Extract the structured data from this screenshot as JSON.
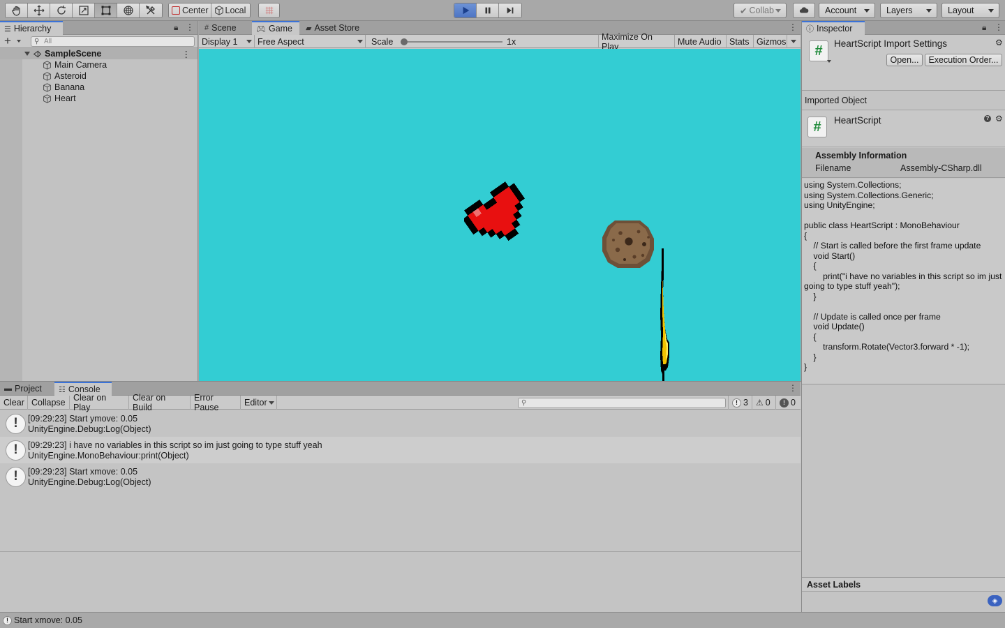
{
  "toolbar": {
    "pivot_label": "Center",
    "space_label": "Local",
    "collab_label": "Collab",
    "account_label": "Account",
    "layers_label": "Layers",
    "layout_label": "Layout"
  },
  "hierarchy": {
    "tab_label": "Hierarchy",
    "search_placeholder": "All",
    "scene_name": "SampleScene",
    "objects": [
      "Main Camera",
      "Asteroid",
      "Banana",
      "Heart"
    ]
  },
  "game": {
    "tabs": [
      "Scene",
      "Game",
      "Asset Store"
    ],
    "active_tab": "Game",
    "display": "Display 1",
    "aspect": "Free Aspect",
    "scale_label": "Scale",
    "scale_value": "1x",
    "scale_fraction": 0.0,
    "maximize_label": "Maximize On Play",
    "mute_label": "Mute Audio",
    "stats_label": "Stats",
    "gizmos_label": "Gizmos",
    "background_color": "#33cdd3"
  },
  "inspector": {
    "tab_label": "Inspector",
    "title": "HeartScript Import Settings",
    "open_label": "Open...",
    "exec_order_label": "Execution Order...",
    "imported_object_label": "Imported Object",
    "script_name": "HeartScript",
    "assembly_heading": "Assembly Information",
    "filename_label": "Filename",
    "filename_value": "Assembly-CSharp.dll",
    "code": "using System.Collections;\nusing System.Collections.Generic;\nusing UnityEngine;\n\npublic class HeartScript : MonoBehaviour\n{\n    // Start is called before the first frame update\n    void Start()\n    {\n        print(\"i have no variables in this script so im just going to type stuff yeah\");\n    }\n\n    // Update is called once per frame\n    void Update()\n    {\n        transform.Rotate(Vector3.forward * -1);\n    }\n}",
    "asset_labels_heading": "Asset Labels"
  },
  "console": {
    "tabs": [
      "Project",
      "Console"
    ],
    "active_tab": "Console",
    "buttons": [
      "Clear",
      "Collapse",
      "Clear on Play",
      "Clear on Build",
      "Error Pause",
      "Editor"
    ],
    "counts": {
      "log": "3",
      "warning": "0",
      "error": "0"
    },
    "logs": [
      {
        "line1": "[09:29:23] Start ymove: 0.05",
        "line2": "UnityEngine.Debug:Log(Object)"
      },
      {
        "line1": "[09:29:23] i have no variables in this script so im just going to type stuff yeah",
        "line2": "UnityEngine.MonoBehaviour:print(Object)"
      },
      {
        "line1": "[09:29:23] Start xmove: 0.05",
        "line2": "UnityEngine.Debug:Log(Object)"
      }
    ]
  },
  "status": {
    "message": "Start xmove: 0.05"
  }
}
